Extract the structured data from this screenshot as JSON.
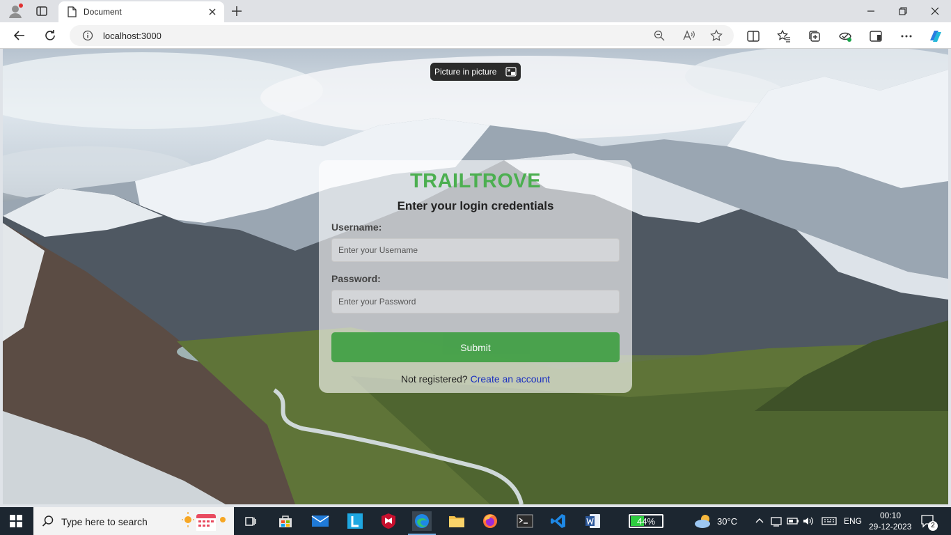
{
  "browser": {
    "tab_title": "Document",
    "url": "localhost:3000",
    "pip_label": "Picture in picture"
  },
  "login": {
    "brand": "TRAILTROVE",
    "subtitle": "Enter your login credentials",
    "username_label": "Username:",
    "username_placeholder": "Enter your Username",
    "password_label": "Password:",
    "password_placeholder": "Enter your Password",
    "submit_label": "Submit",
    "register_prompt": "Not registered?",
    "register_link": "Create an account"
  },
  "colors": {
    "brand": "#4caf50",
    "submit": "#43a047",
    "link": "#1a2fbf"
  },
  "taskbar": {
    "search_placeholder": "Type here to search",
    "battery_level": 0.44,
    "battery_text": "44%",
    "weather": "30°C",
    "language": "ENG",
    "time": "00:10",
    "date": "29-12-2023",
    "notification_count": "2"
  }
}
